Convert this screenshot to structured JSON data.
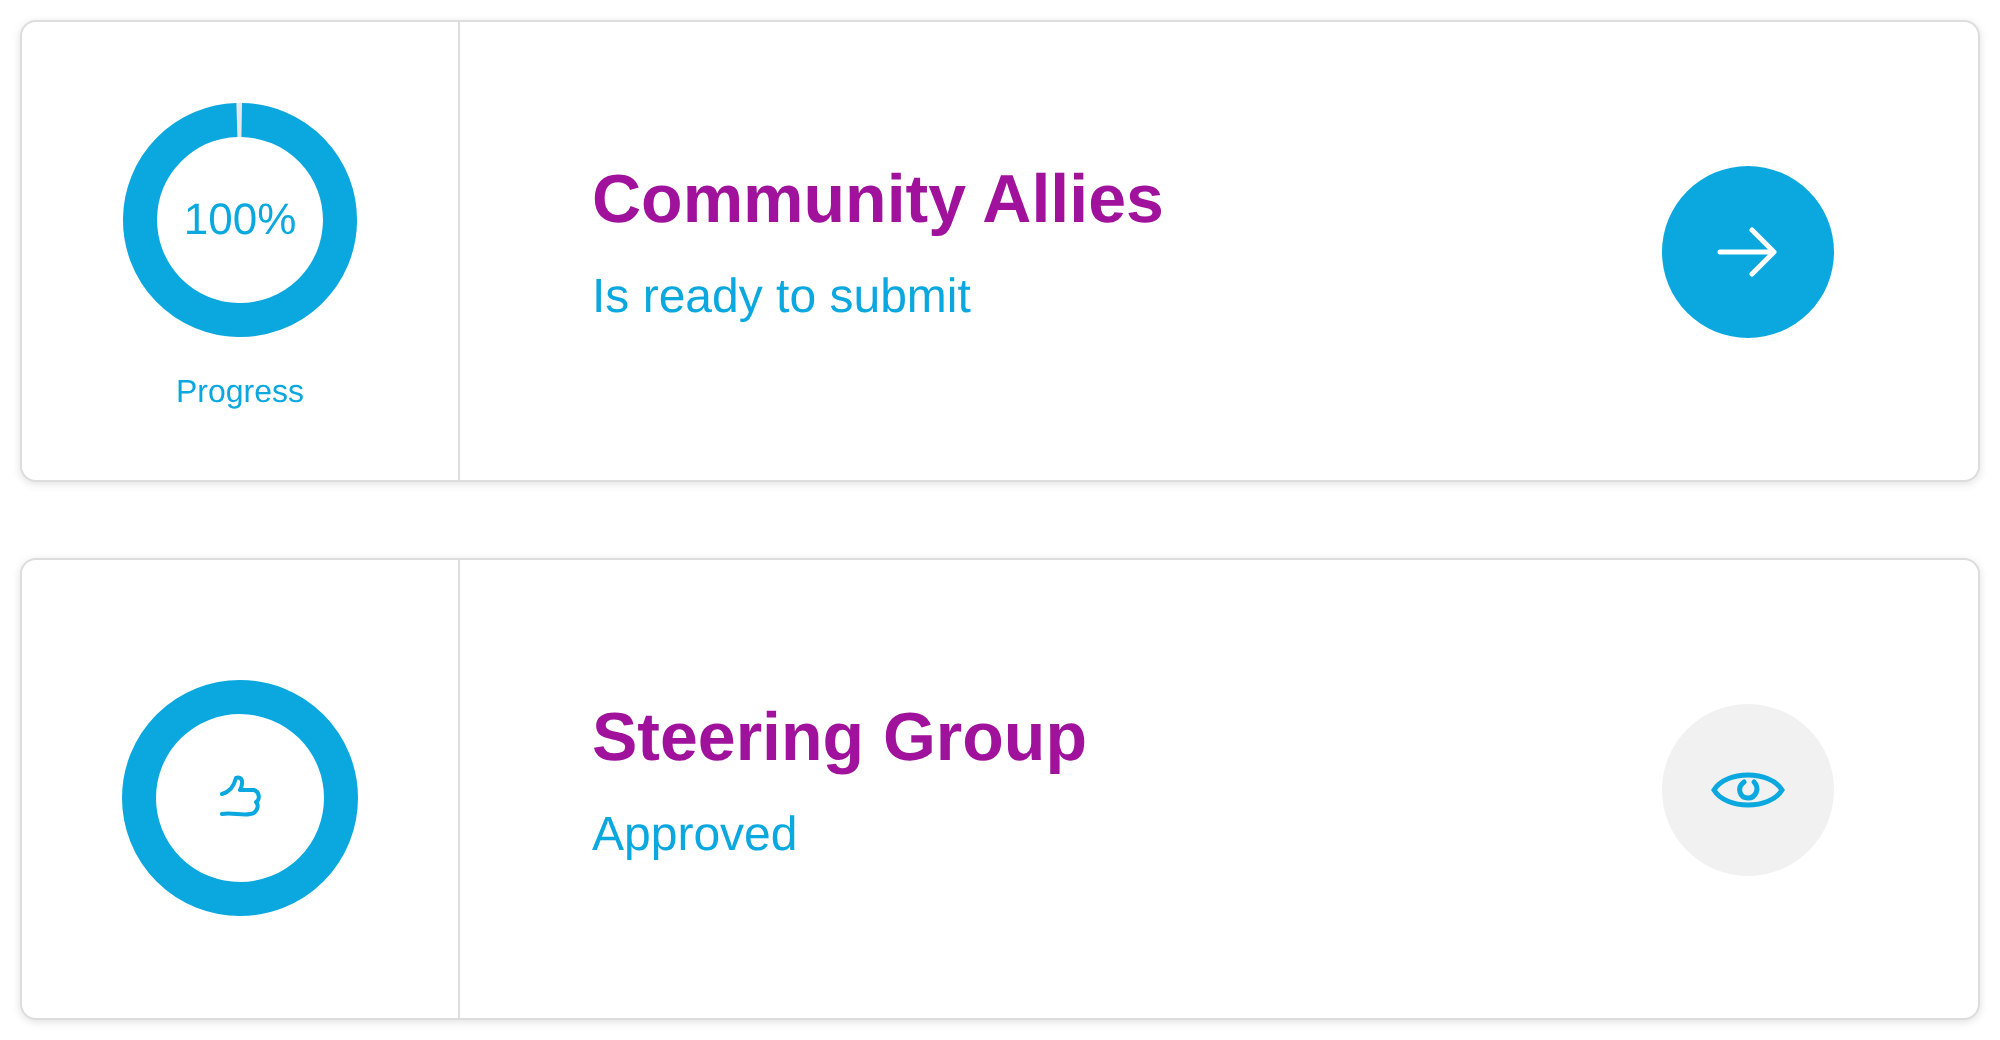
{
  "cards": [
    {
      "kind": "progress",
      "progress": {
        "reading": "100%",
        "label": "Progress"
      },
      "title": "Community Allies",
      "status": "Is ready to submit",
      "action": {
        "kind": "next"
      }
    },
    {
      "kind": "approved",
      "title": "Steering Group",
      "status": "Approved",
      "action": {
        "kind": "view"
      }
    }
  ]
}
